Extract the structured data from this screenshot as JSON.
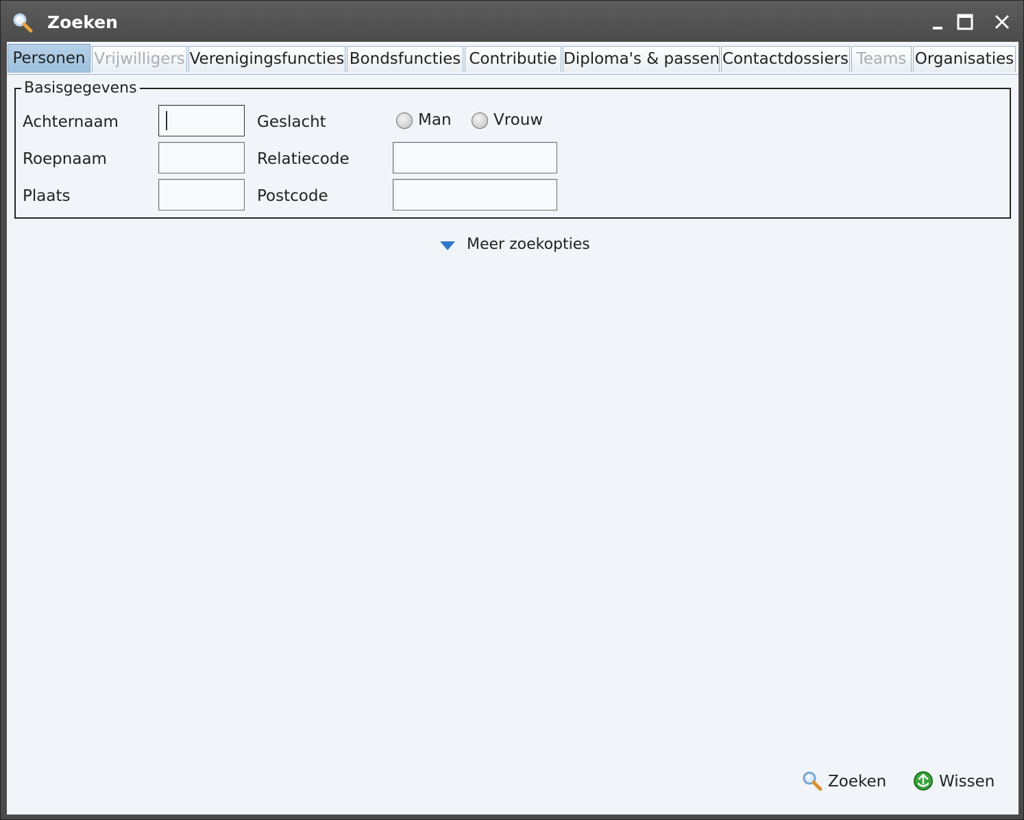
{
  "window": {
    "title": "Zoeken",
    "title_icon": "magnifier-icon",
    "controls": [
      "minimize-icon",
      "maximize-icon",
      "close-icon"
    ]
  },
  "tabs": [
    {
      "label": "Personen",
      "state": "active"
    },
    {
      "label": "Vrijwilligers",
      "state": "disabled"
    },
    {
      "label": "Verenigingsfuncties",
      "state": "normal"
    },
    {
      "label": "Bondsfuncties",
      "state": "normal"
    },
    {
      "label": "Contributie",
      "state": "normal"
    },
    {
      "label": "Diploma's & passen",
      "state": "normal"
    },
    {
      "label": "Contactdossiers",
      "state": "normal"
    },
    {
      "label": "Teams",
      "state": "disabled"
    },
    {
      "label": "Organisaties",
      "state": "normal"
    }
  ],
  "basis": {
    "legend": "Basisgegevens",
    "achternaam_label": "Achternaam",
    "achternaam_value": "",
    "roepnaam_label": "Roepnaam",
    "roepnaam_value": "",
    "plaats_label": "Plaats",
    "plaats_value": "",
    "geslacht_label": "Geslacht",
    "geslacht_options": [
      "Man",
      "Vrouw"
    ],
    "relatiecode_label": "Relatiecode",
    "relatiecode_value": "",
    "postcode_label": "Postcode",
    "postcode_value": ""
  },
  "more_options": {
    "label": "Meer zoekopties",
    "icon": "triangle-down-icon",
    "color": "#2f78c7"
  },
  "actions": {
    "search_label": "Zoeken",
    "search_icon": "magnifier-icon",
    "clear_label": "Wissen",
    "clear_icon": "recycle-icon"
  },
  "colors": {
    "titlebar": "#4b4b4b",
    "client_bg": "#f1f5f9",
    "active_tab": "#9cc0de"
  }
}
